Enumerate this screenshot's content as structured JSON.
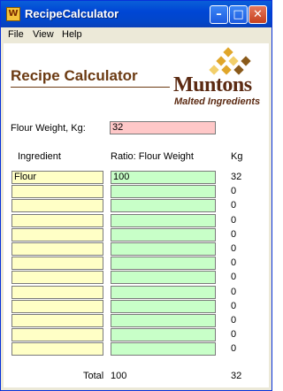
{
  "window": {
    "title": "RecipeCalculator",
    "app_icon_glyph": "W"
  },
  "menu": [
    "File",
    "View",
    "Help"
  ],
  "heading": "Recipe Calculator",
  "logo": {
    "word": "Muntons",
    "tagline": "Malted Ingredients"
  },
  "flour_weight": {
    "label": "Flour Weight, Kg:",
    "value": "32"
  },
  "columns": {
    "ingredient": "Ingredient",
    "ratio": "Ratio: Flour Weight",
    "kg": "Kg"
  },
  "rows": [
    {
      "ingredient": "Flour",
      "ratio": "100",
      "kg": "32"
    },
    {
      "ingredient": "",
      "ratio": "",
      "kg": "0"
    },
    {
      "ingredient": "",
      "ratio": "",
      "kg": "0"
    },
    {
      "ingredient": "",
      "ratio": "",
      "kg": "0"
    },
    {
      "ingredient": "",
      "ratio": "",
      "kg": "0"
    },
    {
      "ingredient": "",
      "ratio": "",
      "kg": "0"
    },
    {
      "ingredient": "",
      "ratio": "",
      "kg": "0"
    },
    {
      "ingredient": "",
      "ratio": "",
      "kg": "0"
    },
    {
      "ingredient": "",
      "ratio": "",
      "kg": "0"
    },
    {
      "ingredient": "",
      "ratio": "",
      "kg": "0"
    },
    {
      "ingredient": "",
      "ratio": "",
      "kg": "0"
    },
    {
      "ingredient": "",
      "ratio": "",
      "kg": "0"
    },
    {
      "ingredient": "",
      "ratio": "",
      "kg": "0"
    }
  ],
  "total": {
    "label": "Total",
    "ratio": "100",
    "kg": "32"
  },
  "colors": {
    "title_bar": "#0046d5",
    "ingredient_field": "#ffffc6",
    "ratio_field": "#c8ffc8",
    "flour_weight_field": "#ffc8c8",
    "brand_brown": "#5b2a12",
    "logo_gold": "#e0a62a"
  }
}
